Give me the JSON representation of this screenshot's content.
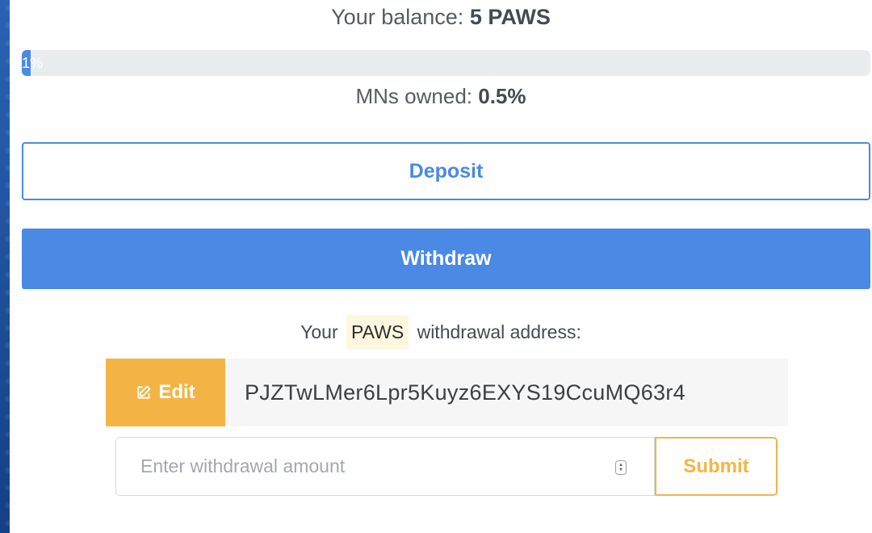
{
  "balance": {
    "label": "Your balance:",
    "value": "5 PAWS"
  },
  "progress": {
    "percent": 1,
    "label": "1%"
  },
  "mns": {
    "label": "MNs owned:",
    "value": "0.5%"
  },
  "buttons": {
    "deposit": "Deposit",
    "withdraw": "Withdraw",
    "edit": "Edit",
    "submit": "Submit"
  },
  "withdrawal": {
    "label_prefix": "Your",
    "coin": "PAWS",
    "label_suffix": "withdrawal address:",
    "address": "PJZTwLMer6Lpr5Kuyz6EXYS19CcuMQ63r4",
    "amount_placeholder": "Enter withdrawal amount",
    "amount_value": ""
  },
  "colors": {
    "primary": "#4a89e4",
    "warning": "#f4b445",
    "background": "#1c4f9c"
  },
  "icons": {
    "edit": "edit-icon",
    "spinner": "number-spinner-icon"
  }
}
